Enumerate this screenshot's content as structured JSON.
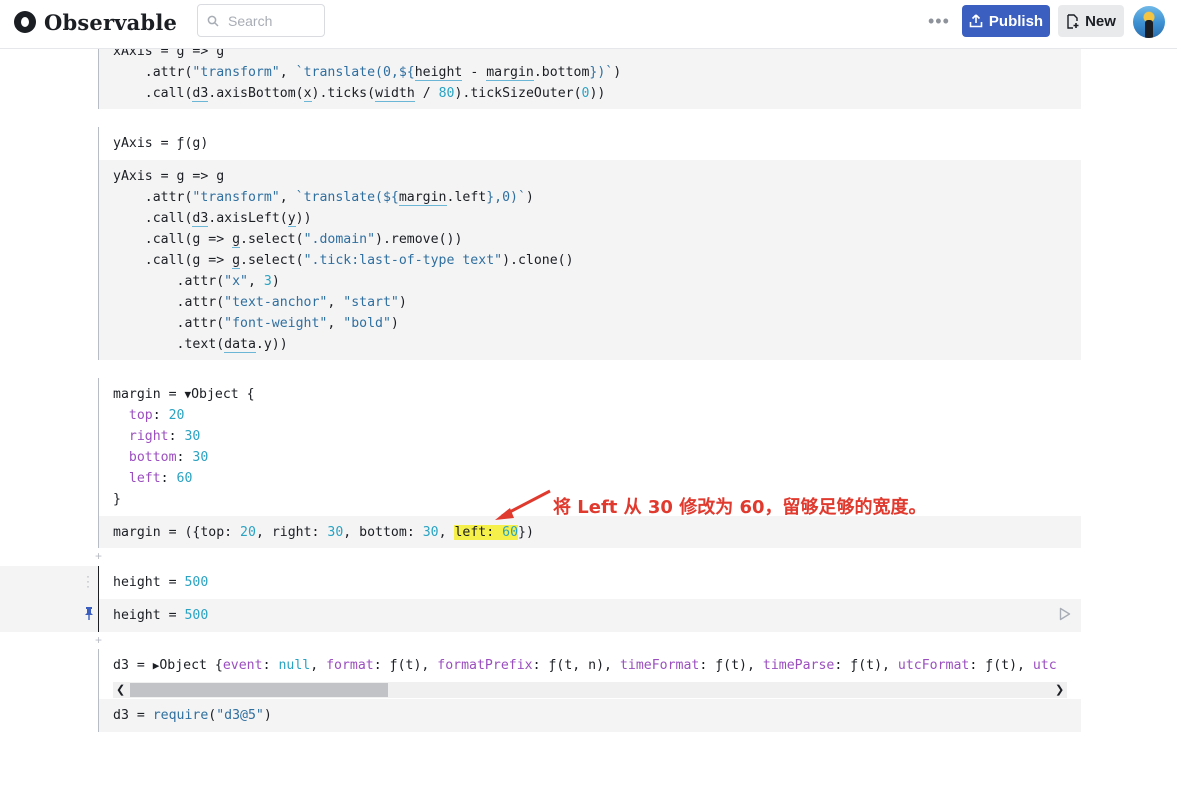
{
  "header": {
    "logo_text": "Observable",
    "search_placeholder": "Search",
    "more_label": "•••",
    "publish_label": "Publish",
    "new_label": "New"
  },
  "cells": {
    "xaxis": {
      "line1": "xAxis = g => g",
      "line2_pre": "    .attr(",
      "line2_s1": "\"transform\"",
      "line2_mid": ", ",
      "line2_s2a": "`translate(0,${",
      "line2_v1": "height",
      "line2_op": " - ",
      "line2_v2": "margin",
      "line2_p": ".bottom",
      "line2_s2b": "})`",
      "line2_end": ")",
      "line3_pre": "    .call(",
      "line3_d3": "d3",
      "line3_a": ".axisBottom(",
      "line3_x": "x",
      "line3_b": ").ticks(",
      "line3_w": "width",
      "line3_c": " / ",
      "line3_n": "80",
      "line3_d": ").tickSizeOuter(",
      "line3_z": "0",
      "line3_e": "))"
    },
    "yaxis_output": "yAxis = ƒ(g)",
    "yaxis": {
      "line1": "yAxis = g => g",
      "l2_pre": "    .attr(",
      "l2_s1": "\"transform\"",
      "l2_mid": ", ",
      "l2_s2a": "`translate(${",
      "l2_v": "margin",
      "l2_p": ".left",
      "l2_s2b": "},0)`",
      "l2_end": ")",
      "l3_pre": "    .call(",
      "l3_d3": "d3",
      "l3_a": ".axisLeft(",
      "l3_y": "y",
      "l3_end": "))",
      "l4_pre": "    .call(g => ",
      "l4_g": "g",
      "l4_a": ".select(",
      "l4_s": "\".domain\"",
      "l4_end": ").remove())",
      "l5_pre": "    .call(g => ",
      "l5_g": "g",
      "l5_a": ".select(",
      "l5_s": "\".tick:last-of-type text\"",
      "l5_end": ").clone()",
      "l6_pre": "        .attr(",
      "l6_s": "\"x\"",
      "l6_mid": ", ",
      "l6_n": "3",
      "l6_end": ")",
      "l7_pre": "        .attr(",
      "l7_s1": "\"text-anchor\"",
      "l7_mid": ", ",
      "l7_s2": "\"start\"",
      "l7_end": ")",
      "l8_pre": "        .attr(",
      "l8_s1": "\"font-weight\"",
      "l8_mid": ", ",
      "l8_s2": "\"bold\"",
      "l8_end": ")",
      "l9_pre": "        .text(",
      "l9_d": "data",
      "l9_end": ".y))"
    },
    "margin_output": {
      "head_pre": "margin = ",
      "head_tri": "▼",
      "head_obj": "Object {",
      "top_k": "top",
      "top_v": "20",
      "right_k": "right",
      "right_v": "30",
      "bottom_k": "bottom",
      "bottom_v": "30",
      "left_k": "left",
      "left_v": "60",
      "close": "}"
    },
    "margin_code": {
      "pre": "margin = ({top: ",
      "top": "20",
      "a": ", right: ",
      "right": "30",
      "b": ", bottom: ",
      "bottom": "30",
      "c": ", ",
      "left_k": "left: ",
      "left": "60",
      "end": "})"
    },
    "height_output": {
      "pre": "height = ",
      "val": "500"
    },
    "height_code": {
      "pre": "height = ",
      "val": "500"
    },
    "d3_output": {
      "pre": "d3 = ",
      "tri": "▶",
      "obj": "Object {",
      "k1": "event",
      "v1": "null",
      "k2": "format",
      "v2": "ƒ(t)",
      "k3": "formatPrefix",
      "v3": "ƒ(t, n)",
      "k4": "timeFormat",
      "v4": "ƒ(t)",
      "k5": "timeParse",
      "v5": "ƒ(t)",
      "k6": "utcFormat",
      "v6": "ƒ(t)",
      "k7": "utc"
    },
    "d3_code": {
      "pre": "d3 = ",
      "fn": "require",
      "open": "(",
      "s": "\"d3@5\"",
      "close": ")"
    }
  },
  "annotation": "将 Left 从 30 修改为 60，留够足够的宽度。",
  "colors": {
    "publish": "#3b5fc0",
    "annotation": "#e03a2f",
    "highlight": "#f5f04a",
    "string": "#2f6f9f",
    "number": "#2aa3c2",
    "key": "#9b4fbf"
  }
}
